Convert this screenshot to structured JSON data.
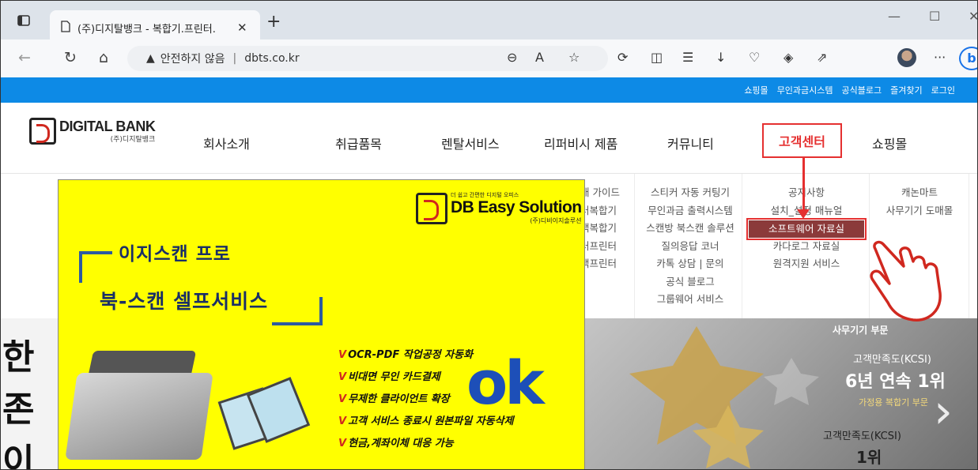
{
  "browser": {
    "tab_title": "(주)디지탈뱅크 - 복합기.프린터.",
    "new_tab": "+",
    "security_label": "안전하지 않음",
    "url": "dbts.co.kr"
  },
  "topbar": {
    "links": [
      "쇼핑몰",
      "무인과금시스템",
      "공식블로그",
      "즐겨찾기",
      "로그인"
    ]
  },
  "header": {
    "logo_main": "DIGITAL BANK",
    "logo_sub": "(주)디지탈뱅크",
    "nav": [
      "회사소개",
      "취급품목",
      "렌탈서비스",
      "리퍼비시 제품",
      "커뮤니티",
      "고객센터",
      "쇼핑몰"
    ]
  },
  "submenu": {
    "col_guide": [
      "매 가이드",
      "러복합기",
      "백복합기",
      "러프린터",
      "백프린터"
    ],
    "col_community": [
      "스티커 자동 커팅기",
      "무인과금 출력시스템",
      "스캔방 북스캔 솔루션",
      "질의응답 코너",
      "카톡 상담 | 문의",
      "공식 블로그",
      "그룹웨어 서비스"
    ],
    "col_support": [
      "공지사항",
      "설치_설정 매뉴얼",
      "소프트웨어 자료실",
      "카다로그 자료실",
      "원격지원 서비스"
    ],
    "col_shop": [
      "캐논마트",
      "사무기기 도매몰"
    ]
  },
  "banner": {
    "left_chars": [
      "한",
      "존",
      "이"
    ],
    "award_category": "사무기기 부문",
    "award1_label": "고객만족도(KCSI)",
    "award1_big": "6년 연속 1위",
    "award1_sub": "가정용 복합기 부문",
    "award2_label": "고객만족도(KCSI)",
    "award2_big": "1위"
  },
  "popup": {
    "brand_tag": "더 쉽고 간편한 디지털 오피스",
    "brand_title": "DB Easy Solution",
    "brand_sub": "(주)디비이지솔루션",
    "title": "이지스캔 프로",
    "subtitle": "북-스캔 셀프서비스",
    "features": [
      "OCR-PDF 작업공정 자동화",
      "비대면 무인 카드결제",
      "무제한 클라이언트 확장",
      "고객 서비스 종료시 원본파일 자동삭제",
      "현금,계좌이체 대응 가능"
    ],
    "ok_text": "ok"
  },
  "colors": {
    "accent": "#0d8ae6",
    "highlight": "#e53030",
    "popup_bg": "#ffff00"
  }
}
